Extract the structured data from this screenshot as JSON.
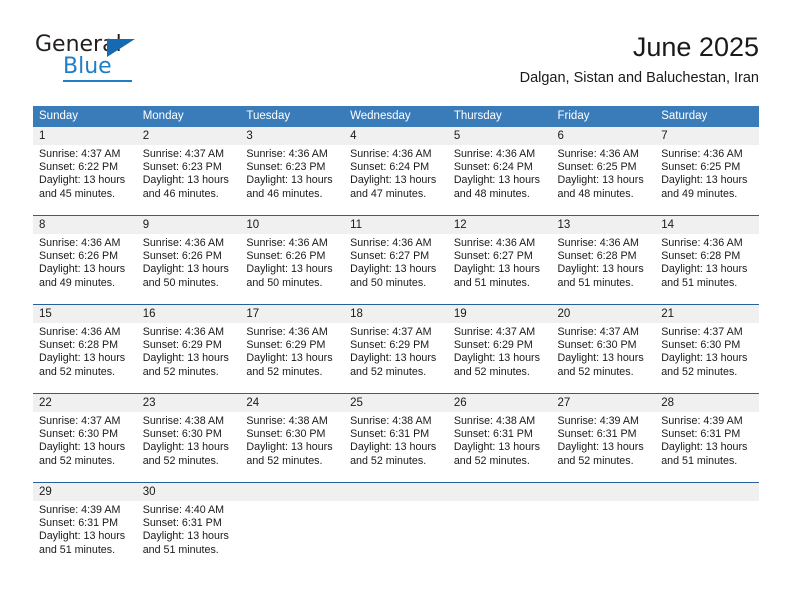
{
  "logo": {
    "word_top": "General",
    "word_bottom": "Blue",
    "triangle_color": "#1769b0",
    "blue_color": "#1f7fc4"
  },
  "header": {
    "title": "June 2025",
    "subtitle": "Dalgan, Sistan and Baluchestan, Iran"
  },
  "theme": {
    "header_bg": "#3a7cb9",
    "header_text": "#ffffff",
    "daynum_bg": "#f0f0f0",
    "week_divider": "#2a6099"
  },
  "columns": [
    "Sunday",
    "Monday",
    "Tuesday",
    "Wednesday",
    "Thursday",
    "Friday",
    "Saturday"
  ],
  "weeks": [
    [
      {
        "day": "1",
        "sunrise": "Sunrise: 4:37 AM",
        "sunset": "Sunset: 6:22 PM",
        "daylight_1": "Daylight: 13 hours",
        "daylight_2": "and 45 minutes."
      },
      {
        "day": "2",
        "sunrise": "Sunrise: 4:37 AM",
        "sunset": "Sunset: 6:23 PM",
        "daylight_1": "Daylight: 13 hours",
        "daylight_2": "and 46 minutes."
      },
      {
        "day": "3",
        "sunrise": "Sunrise: 4:36 AM",
        "sunset": "Sunset: 6:23 PM",
        "daylight_1": "Daylight: 13 hours",
        "daylight_2": "and 46 minutes."
      },
      {
        "day": "4",
        "sunrise": "Sunrise: 4:36 AM",
        "sunset": "Sunset: 6:24 PM",
        "daylight_1": "Daylight: 13 hours",
        "daylight_2": "and 47 minutes."
      },
      {
        "day": "5",
        "sunrise": "Sunrise: 4:36 AM",
        "sunset": "Sunset: 6:24 PM",
        "daylight_1": "Daylight: 13 hours",
        "daylight_2": "and 48 minutes."
      },
      {
        "day": "6",
        "sunrise": "Sunrise: 4:36 AM",
        "sunset": "Sunset: 6:25 PM",
        "daylight_1": "Daylight: 13 hours",
        "daylight_2": "and 48 minutes."
      },
      {
        "day": "7",
        "sunrise": "Sunrise: 4:36 AM",
        "sunset": "Sunset: 6:25 PM",
        "daylight_1": "Daylight: 13 hours",
        "daylight_2": "and 49 minutes."
      }
    ],
    [
      {
        "day": "8",
        "sunrise": "Sunrise: 4:36 AM",
        "sunset": "Sunset: 6:26 PM",
        "daylight_1": "Daylight: 13 hours",
        "daylight_2": "and 49 minutes."
      },
      {
        "day": "9",
        "sunrise": "Sunrise: 4:36 AM",
        "sunset": "Sunset: 6:26 PM",
        "daylight_1": "Daylight: 13 hours",
        "daylight_2": "and 50 minutes."
      },
      {
        "day": "10",
        "sunrise": "Sunrise: 4:36 AM",
        "sunset": "Sunset: 6:26 PM",
        "daylight_1": "Daylight: 13 hours",
        "daylight_2": "and 50 minutes."
      },
      {
        "day": "11",
        "sunrise": "Sunrise: 4:36 AM",
        "sunset": "Sunset: 6:27 PM",
        "daylight_1": "Daylight: 13 hours",
        "daylight_2": "and 50 minutes."
      },
      {
        "day": "12",
        "sunrise": "Sunrise: 4:36 AM",
        "sunset": "Sunset: 6:27 PM",
        "daylight_1": "Daylight: 13 hours",
        "daylight_2": "and 51 minutes."
      },
      {
        "day": "13",
        "sunrise": "Sunrise: 4:36 AM",
        "sunset": "Sunset: 6:28 PM",
        "daylight_1": "Daylight: 13 hours",
        "daylight_2": "and 51 minutes."
      },
      {
        "day": "14",
        "sunrise": "Sunrise: 4:36 AM",
        "sunset": "Sunset: 6:28 PM",
        "daylight_1": "Daylight: 13 hours",
        "daylight_2": "and 51 minutes."
      }
    ],
    [
      {
        "day": "15",
        "sunrise": "Sunrise: 4:36 AM",
        "sunset": "Sunset: 6:28 PM",
        "daylight_1": "Daylight: 13 hours",
        "daylight_2": "and 52 minutes."
      },
      {
        "day": "16",
        "sunrise": "Sunrise: 4:36 AM",
        "sunset": "Sunset: 6:29 PM",
        "daylight_1": "Daylight: 13 hours",
        "daylight_2": "and 52 minutes."
      },
      {
        "day": "17",
        "sunrise": "Sunrise: 4:36 AM",
        "sunset": "Sunset: 6:29 PM",
        "daylight_1": "Daylight: 13 hours",
        "daylight_2": "and 52 minutes."
      },
      {
        "day": "18",
        "sunrise": "Sunrise: 4:37 AM",
        "sunset": "Sunset: 6:29 PM",
        "daylight_1": "Daylight: 13 hours",
        "daylight_2": "and 52 minutes."
      },
      {
        "day": "19",
        "sunrise": "Sunrise: 4:37 AM",
        "sunset": "Sunset: 6:29 PM",
        "daylight_1": "Daylight: 13 hours",
        "daylight_2": "and 52 minutes."
      },
      {
        "day": "20",
        "sunrise": "Sunrise: 4:37 AM",
        "sunset": "Sunset: 6:30 PM",
        "daylight_1": "Daylight: 13 hours",
        "daylight_2": "and 52 minutes."
      },
      {
        "day": "21",
        "sunrise": "Sunrise: 4:37 AM",
        "sunset": "Sunset: 6:30 PM",
        "daylight_1": "Daylight: 13 hours",
        "daylight_2": "and 52 minutes."
      }
    ],
    [
      {
        "day": "22",
        "sunrise": "Sunrise: 4:37 AM",
        "sunset": "Sunset: 6:30 PM",
        "daylight_1": "Daylight: 13 hours",
        "daylight_2": "and 52 minutes."
      },
      {
        "day": "23",
        "sunrise": "Sunrise: 4:38 AM",
        "sunset": "Sunset: 6:30 PM",
        "daylight_1": "Daylight: 13 hours",
        "daylight_2": "and 52 minutes."
      },
      {
        "day": "24",
        "sunrise": "Sunrise: 4:38 AM",
        "sunset": "Sunset: 6:30 PM",
        "daylight_1": "Daylight: 13 hours",
        "daylight_2": "and 52 minutes."
      },
      {
        "day": "25",
        "sunrise": "Sunrise: 4:38 AM",
        "sunset": "Sunset: 6:31 PM",
        "daylight_1": "Daylight: 13 hours",
        "daylight_2": "and 52 minutes."
      },
      {
        "day": "26",
        "sunrise": "Sunrise: 4:38 AM",
        "sunset": "Sunset: 6:31 PM",
        "daylight_1": "Daylight: 13 hours",
        "daylight_2": "and 52 minutes."
      },
      {
        "day": "27",
        "sunrise": "Sunrise: 4:39 AM",
        "sunset": "Sunset: 6:31 PM",
        "daylight_1": "Daylight: 13 hours",
        "daylight_2": "and 52 minutes."
      },
      {
        "day": "28",
        "sunrise": "Sunrise: 4:39 AM",
        "sunset": "Sunset: 6:31 PM",
        "daylight_1": "Daylight: 13 hours",
        "daylight_2": "and 51 minutes."
      }
    ],
    [
      {
        "day": "29",
        "sunrise": "Sunrise: 4:39 AM",
        "sunset": "Sunset: 6:31 PM",
        "daylight_1": "Daylight: 13 hours",
        "daylight_2": "and 51 minutes."
      },
      {
        "day": "30",
        "sunrise": "Sunrise: 4:40 AM",
        "sunset": "Sunset: 6:31 PM",
        "daylight_1": "Daylight: 13 hours",
        "daylight_2": "and 51 minutes."
      },
      {
        "day": "",
        "sunrise": "",
        "sunset": "",
        "daylight_1": "",
        "daylight_2": ""
      },
      {
        "day": "",
        "sunrise": "",
        "sunset": "",
        "daylight_1": "",
        "daylight_2": ""
      },
      {
        "day": "",
        "sunrise": "",
        "sunset": "",
        "daylight_1": "",
        "daylight_2": ""
      },
      {
        "day": "",
        "sunrise": "",
        "sunset": "",
        "daylight_1": "",
        "daylight_2": ""
      },
      {
        "day": "",
        "sunrise": "",
        "sunset": "",
        "daylight_1": "",
        "daylight_2": ""
      }
    ]
  ]
}
